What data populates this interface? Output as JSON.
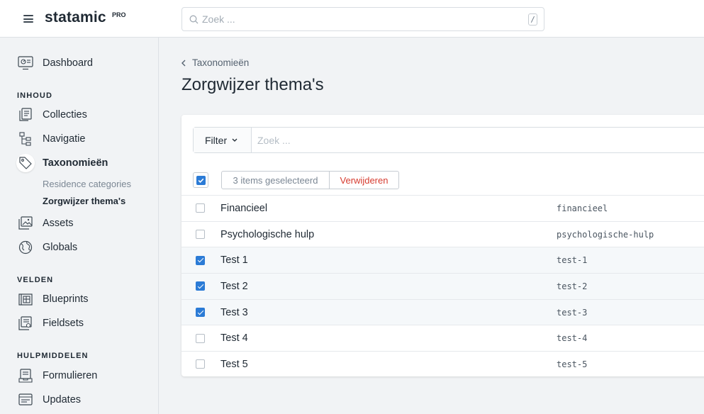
{
  "header": {
    "brand": "statamic",
    "brand_badge": "PRO",
    "search_placeholder": "Zoek ...",
    "search_shortcut": "/"
  },
  "sidebar": {
    "dashboard": "Dashboard",
    "sections": {
      "content": "INHOUD",
      "fields": "VELDEN",
      "tools": "HULPMIDDELEN"
    },
    "items": {
      "collections": "Collecties",
      "navigation": "Navigatie",
      "taxonomies": "Taxonomieën",
      "taxonomy_sub": [
        "Residence categories",
        "Zorgwijzer thema's"
      ],
      "assets": "Assets",
      "globals": "Globals",
      "blueprints": "Blueprints",
      "fieldsets": "Fieldsets",
      "forms": "Formulieren",
      "updates": "Updates"
    }
  },
  "main": {
    "breadcrumb": "Taxonomieën",
    "title": "Zorgwijzer thema's",
    "filter_label": "Filter",
    "search_placeholder": "Zoek ...",
    "bulk": {
      "count_label": "3 items geselecteerd",
      "delete_label": "Verwijderen"
    },
    "terms": [
      {
        "title": "Financieel",
        "slug": "financieel",
        "checked": false
      },
      {
        "title": "Psychologische hulp",
        "slug": "psychologische-hulp",
        "checked": false
      },
      {
        "title": "Test 1",
        "slug": "test-1",
        "checked": true
      },
      {
        "title": "Test 2",
        "slug": "test-2",
        "checked": true
      },
      {
        "title": "Test 3",
        "slug": "test-3",
        "checked": true
      },
      {
        "title": "Test 4",
        "slug": "test-4",
        "checked": false
      },
      {
        "title": "Test 5",
        "slug": "test-5",
        "checked": false
      }
    ]
  },
  "colors": {
    "accent": "#2b7bd6",
    "danger": "#d63b2f",
    "background": "#f1f3f5"
  }
}
